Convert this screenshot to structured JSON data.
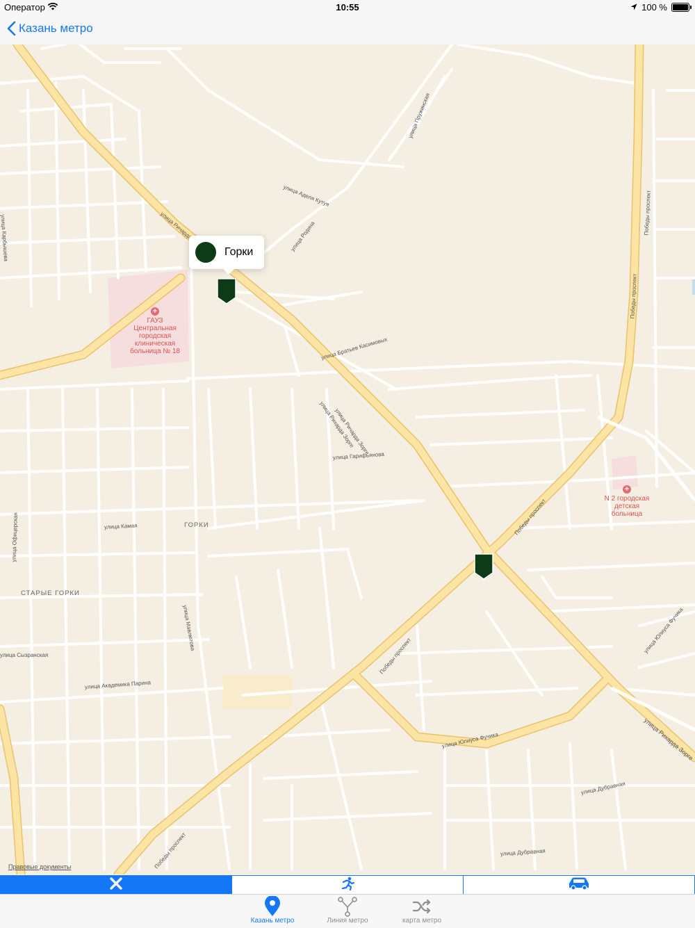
{
  "status_bar": {
    "carrier": "Оператор",
    "time": "10:55",
    "battery": "100 %"
  },
  "nav": {
    "back_label": "Казань метро"
  },
  "map": {
    "callout_title": "Горки",
    "legal_link": "Правовые документы",
    "place_labels": [
      "ГОРКИ",
      "СТАРЫЕ ГОРКИ"
    ],
    "poi": [
      {
        "name": "ГАУЗ Центральная городская клиническая больница № 18",
        "lines": [
          "ГАУЗ",
          "Центральная",
          "городская",
          "клиническая",
          "больница № 18"
        ]
      },
      {
        "name": "N 2 городская детская больница",
        "lines": [
          "N 2 городская",
          "детская",
          "больница"
        ]
      }
    ],
    "streets": [
      "улица Ричарда Зорге",
      "улица Родина",
      "улица Аделя Кутуя",
      "улица Братьев Касимовых",
      "улица Гарифьянова",
      "улица Камая",
      "улица Академика Парина",
      "улица Юлиуса Фучика",
      "улица Дубравная",
      "Победы проспект",
      "улица Сызранская",
      "улица Маяковского",
      "улица Пружинская",
      "улица Офицерская",
      "улица Карбышева",
      "улица Мавлютова",
      "улица Рихарда Зорге"
    ],
    "marker_color": "#0d3b17"
  },
  "segments": [
    {
      "name": "close",
      "icon": "close-icon",
      "active": true
    },
    {
      "name": "walk",
      "icon": "walk-icon",
      "active": false
    },
    {
      "name": "car",
      "icon": "car-icon",
      "active": false
    }
  ],
  "tabs": [
    {
      "label": "Казань метро",
      "icon": "location-pin-icon",
      "active": true
    },
    {
      "label": "Линия метро",
      "icon": "metro-line-icon",
      "active": false
    },
    {
      "label": "карта метро",
      "icon": "shuffle-icon",
      "active": false
    }
  ],
  "colors": {
    "accent": "#1478f6",
    "map_bg": "#f5efe3",
    "major_road": "#f8d98a",
    "hospital_area": "#f6dede"
  }
}
